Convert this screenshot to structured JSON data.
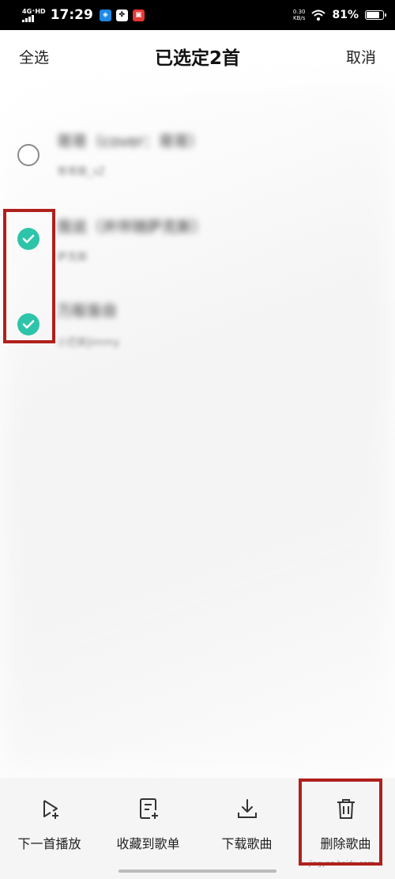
{
  "status_bar": {
    "network": "4G⁺HD",
    "time": "17:29",
    "speed_value": "0.30",
    "speed_unit": "KB/s",
    "battery_percent": "81%",
    "battery_level": 0.81,
    "app_icons": [
      "shield-app-icon",
      "pinwheel-app-icon",
      "red-app-icon"
    ]
  },
  "header": {
    "select_all": "全选",
    "title": "已选定2首",
    "cancel": "取消"
  },
  "songs": [
    {
      "title": "哥哥（cover：哥哥）",
      "subtitle": "哥哥歌_sZ",
      "checked": false
    },
    {
      "title": "我说（并伴随萨克斯）",
      "subtitle": "萨克斯",
      "checked": true
    },
    {
      "title": "万般皆自",
      "subtitle": "小巴新Jimmy",
      "checked": true
    }
  ],
  "toolbar": {
    "play_next": "下一首播放",
    "add_to_playlist": "收藏到歌单",
    "download": "下载歌曲",
    "delete": "删除歌曲"
  },
  "colors": {
    "accent": "#2ec4a9",
    "annotation": "#b0201c"
  },
  "watermark": "jingyan.baidu.com"
}
